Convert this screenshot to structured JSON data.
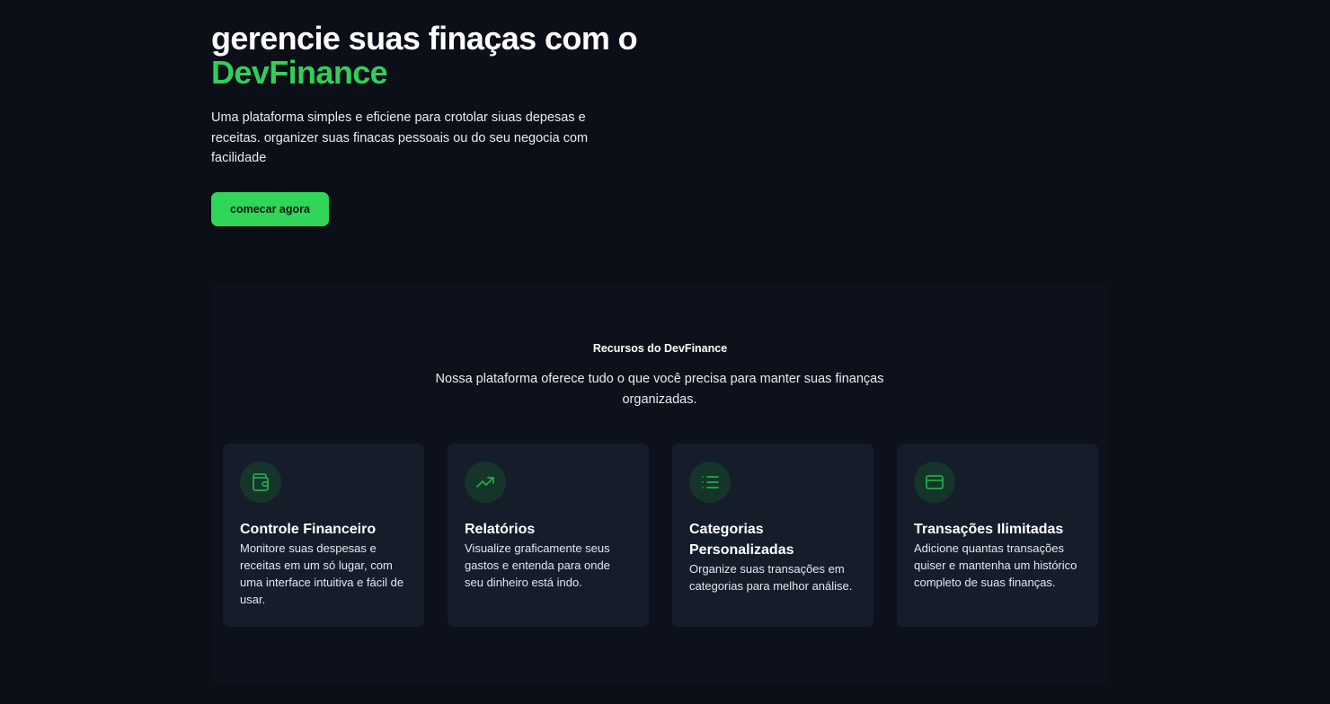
{
  "hero": {
    "title_prefix": "gerencie suas finaças com o ",
    "title_accent": "DevFinance",
    "description": "Uma plataforma simples e eficiene para crotolar siuas depesas e receitas. organizer suas finacas pessoais ou do seu negocia com facilidade",
    "cta_label": "comecar agora"
  },
  "features": {
    "title": "Recursos do DevFinance",
    "subtitle": "Nossa plataforma oferece tudo o que você precisa para manter suas finanças organizadas.",
    "cards": [
      {
        "icon": "wallet-icon",
        "title": "Controle Financeiro",
        "description": "Monitore suas despesas e receitas em um só lugar, com uma interface intuitiva e fácil de usar."
      },
      {
        "icon": "trending-up-icon",
        "title": "Relatórios",
        "description": "Visualize graficamente seus gastos e entenda para onde seu dinheiro está indo."
      },
      {
        "icon": "list-icon",
        "title": "Categorias Personalizadas",
        "description": "Organize suas transações em categorias para melhor análise."
      },
      {
        "icon": "credit-card-icon",
        "title": "Transações Ilimitadas",
        "description": "Adicione quantas transações quiser e mantenha um histórico completo de suas finanças."
      }
    ]
  },
  "colors": {
    "background": "#0b0f17",
    "accent": "#2fd05a",
    "card_background": "#151d2a",
    "icon_circle": "#15342a"
  }
}
